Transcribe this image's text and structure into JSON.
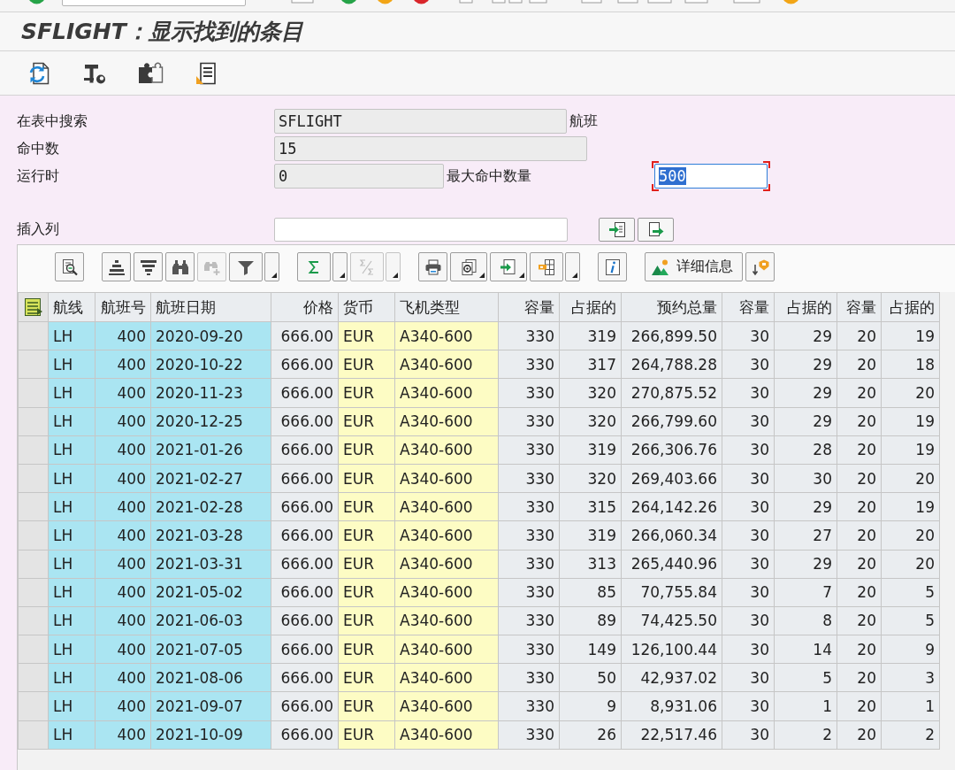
{
  "title": "SFLIGHT：显示找到的条目",
  "form": {
    "rows": [
      {
        "label": "在表中搜索",
        "field": {
          "value": "SFLIGHT",
          "editable": false,
          "focused": false
        },
        "suffix": "航班"
      },
      {
        "label": "命中数",
        "field": {
          "value": "15",
          "editable": false,
          "focused": false
        }
      },
      {
        "label": "运行时",
        "field": {
          "value": "0",
          "editable": false,
          "focused": false
        },
        "suffix": "最大命中数量",
        "extra_field": {
          "value": "500",
          "editable": true,
          "focused": true
        }
      }
    ],
    "insert_column": {
      "label": "插入列",
      "field": {
        "editable": true,
        "focused": false
      }
    }
  },
  "alv_toolbar": [
    {
      "buttons": [
        {
          "kind": "details",
          "disabled": false,
          "dropdown": false
        }
      ]
    },
    {
      "buttons": [
        {
          "kind": "sort_ascending",
          "disabled": false,
          "dropdown": false
        },
        {
          "kind": "sort_descending",
          "disabled": false,
          "dropdown": false
        },
        {
          "kind": "find",
          "disabled": false,
          "dropdown": false
        },
        {
          "kind": "find_next",
          "disabled": true,
          "dropdown": false
        },
        {
          "kind": "filter",
          "disabled": false,
          "dropdown": true,
          "split": true
        }
      ]
    },
    {
      "buttons": [
        {
          "kind": "sum",
          "disabled": false,
          "dropdown": true,
          "split": true
        },
        {
          "kind": "subtotal",
          "disabled": true,
          "dropdown": true,
          "split": true
        }
      ]
    },
    {
      "buttons": [
        {
          "kind": "print",
          "disabled": false,
          "dropdown": false
        },
        {
          "kind": "views",
          "disabled": false,
          "dropdown": true,
          "split": false
        },
        {
          "kind": "export",
          "disabled": false,
          "dropdown": true,
          "split": false
        },
        {
          "kind": "layout",
          "disabled": false,
          "dropdown": true,
          "split": true
        }
      ]
    },
    {
      "buttons": [
        {
          "kind": "info",
          "disabled": false,
          "dropdown": false
        }
      ]
    },
    {
      "buttons": [
        {
          "kind": "detail_info",
          "label": "详细信息",
          "disabled": false,
          "dropdown": false
        },
        {
          "kind": "extras",
          "disabled": false,
          "dropdown": false
        }
      ]
    }
  ],
  "table": {
    "columns": [
      {
        "label": "航线",
        "kind": "key",
        "numeric": false
      },
      {
        "label": "航班号",
        "kind": "key",
        "numeric": true
      },
      {
        "label": "航班日期",
        "kind": "key",
        "numeric": false
      },
      {
        "label": "价格",
        "kind": "value",
        "numeric": true
      },
      {
        "label": "货币",
        "kind": "unit",
        "numeric": false
      },
      {
        "label": "飞机类型",
        "kind": "unit",
        "numeric": false
      },
      {
        "label": "容量",
        "kind": "value",
        "numeric": true
      },
      {
        "label": "占据的",
        "kind": "value",
        "numeric": true
      },
      {
        "label": "预约总量",
        "kind": "value",
        "numeric": true
      },
      {
        "label": "容量",
        "kind": "value",
        "numeric": true
      },
      {
        "label": "占据的",
        "kind": "value",
        "numeric": true
      },
      {
        "label": "容量",
        "kind": "value",
        "numeric": true
      },
      {
        "label": "占据的",
        "kind": "value",
        "numeric": true
      }
    ],
    "rows": [
      [
        "LH",
        "400",
        "2020-09-20",
        "666.00",
        "EUR",
        "A340-600",
        "330",
        "319",
        "266,899.50",
        "30",
        "29",
        "20",
        "19"
      ],
      [
        "LH",
        "400",
        "2020-10-22",
        "666.00",
        "EUR",
        "A340-600",
        "330",
        "317",
        "264,788.28",
        "30",
        "29",
        "20",
        "18"
      ],
      [
        "LH",
        "400",
        "2020-11-23",
        "666.00",
        "EUR",
        "A340-600",
        "330",
        "320",
        "270,875.52",
        "30",
        "29",
        "20",
        "20"
      ],
      [
        "LH",
        "400",
        "2020-12-25",
        "666.00",
        "EUR",
        "A340-600",
        "330",
        "320",
        "266,799.60",
        "30",
        "29",
        "20",
        "19"
      ],
      [
        "LH",
        "400",
        "2021-01-26",
        "666.00",
        "EUR",
        "A340-600",
        "330",
        "319",
        "266,306.76",
        "30",
        "28",
        "20",
        "19"
      ],
      [
        "LH",
        "400",
        "2021-02-27",
        "666.00",
        "EUR",
        "A340-600",
        "330",
        "320",
        "269,403.66",
        "30",
        "30",
        "20",
        "20"
      ],
      [
        "LH",
        "400",
        "2021-02-28",
        "666.00",
        "EUR",
        "A340-600",
        "330",
        "315",
        "264,142.26",
        "30",
        "29",
        "20",
        "19"
      ],
      [
        "LH",
        "400",
        "2021-03-28",
        "666.00",
        "EUR",
        "A340-600",
        "330",
        "319",
        "266,060.34",
        "30",
        "27",
        "20",
        "20"
      ],
      [
        "LH",
        "400",
        "2021-03-31",
        "666.00",
        "EUR",
        "A340-600",
        "330",
        "313",
        "265,440.96",
        "30",
        "29",
        "20",
        "20"
      ],
      [
        "LH",
        "400",
        "2021-05-02",
        "666.00",
        "EUR",
        "A340-600",
        "330",
        "85",
        "70,755.84",
        "30",
        "7",
        "20",
        "5"
      ],
      [
        "LH",
        "400",
        "2021-06-03",
        "666.00",
        "EUR",
        "A340-600",
        "330",
        "89",
        "74,425.50",
        "30",
        "8",
        "20",
        "5"
      ],
      [
        "LH",
        "400",
        "2021-07-05",
        "666.00",
        "EUR",
        "A340-600",
        "330",
        "149",
        "126,100.44",
        "30",
        "14",
        "20",
        "9"
      ],
      [
        "LH",
        "400",
        "2021-08-06",
        "666.00",
        "EUR",
        "A340-600",
        "330",
        "50",
        "42,937.02",
        "30",
        "5",
        "20",
        "3"
      ],
      [
        "LH",
        "400",
        "2021-09-07",
        "666.00",
        "EUR",
        "A340-600",
        "330",
        "9",
        "8,931.06",
        "30",
        "1",
        "20",
        "1"
      ],
      [
        "LH",
        "400",
        "2021-10-09",
        "666.00",
        "EUR",
        "A340-600",
        "330",
        "26",
        "22,517.46",
        "30",
        "2",
        "20",
        "2"
      ]
    ]
  }
}
